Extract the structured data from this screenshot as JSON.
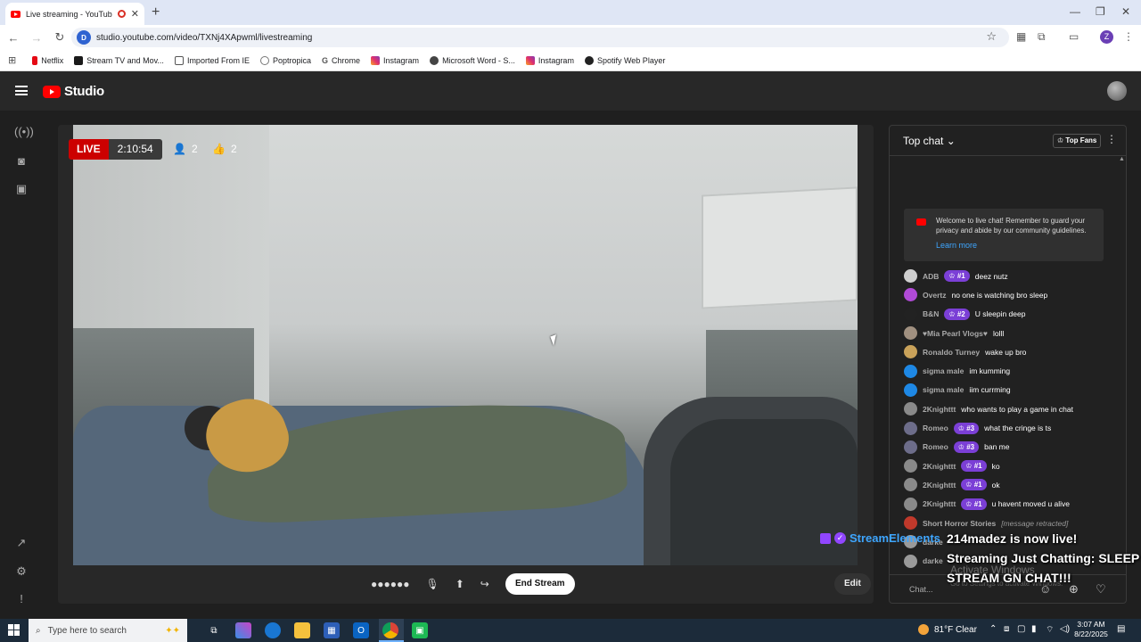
{
  "browser": {
    "tab_title": "Live streaming - YouTube Studio",
    "url": "studio.youtube.com/video/TXNj4XApwml/livestreaming",
    "profile_initial": "Z",
    "bookmarks": [
      "Netflix",
      "Stream TV and Mov...",
      "Imported From IE",
      "Poptropica",
      "Chrome",
      "Instagram",
      "Microsoft Word - S...",
      "Instagram",
      "Spotify Web Player"
    ]
  },
  "studio": {
    "logo_text": "Studio"
  },
  "stream": {
    "live_label": "LIVE",
    "elapsed": "2:10:54",
    "viewers": "2",
    "likes": "2",
    "end_label": "End Stream",
    "edit_label": "Edit"
  },
  "chat": {
    "title": "Top chat",
    "top_fans_label": "Top Fans",
    "welcome_text": "Welcome to live chat! Remember to guard your privacy and abide by our community guidelines.",
    "learn_more": "Learn more",
    "input_placeholder": "Chat...",
    "messages": [
      {
        "author": "ADB",
        "badge": "#1",
        "text": "deez nutz",
        "color": "#cfcfcf"
      },
      {
        "author": "Overtz",
        "badge": "",
        "text": "no one is watching bro sleep",
        "color": "#b04ad6"
      },
      {
        "author": "B&N",
        "badge": "#2",
        "text": "U sleepin deep",
        "color": "#222222"
      },
      {
        "author": "♥Mia Pearl Vlogs♥",
        "badge": "",
        "text": "lolll",
        "color": "#a09080"
      },
      {
        "author": "Ronaldo Turney",
        "badge": "",
        "text": "wake up bro",
        "color": "#c9a25a"
      },
      {
        "author": "sigma male",
        "badge": "",
        "text": "im kumming",
        "color": "#1e88e5"
      },
      {
        "author": "sigma male",
        "badge": "",
        "text": "iim currming",
        "color": "#1e88e5"
      },
      {
        "author": "2Knighttt",
        "badge": "",
        "text": "who wants to play a game in chat",
        "color": "#8a8a8a"
      },
      {
        "author": "Romeo",
        "badge": "#3",
        "text": "what the cringe is ts",
        "color": "#6d6d8a"
      },
      {
        "author": "Romeo",
        "badge": "#3",
        "text": "ban me",
        "color": "#6d6d8a"
      },
      {
        "author": "2Knighttt",
        "badge": "#1",
        "text": "ko",
        "color": "#8a8a8a"
      },
      {
        "author": "2Knighttt",
        "badge": "#1",
        "text": "ok",
        "color": "#8a8a8a"
      },
      {
        "author": "2Knighttt",
        "badge": "#1",
        "text": "u havent moved u alive",
        "color": "#8a8a8a"
      },
      {
        "author": "Short Horror Stories",
        "badge": "",
        "text": "[message retracted]",
        "color": "#c0392b",
        "retracted": true
      },
      {
        "author": "darke",
        "badge": "",
        "text": "",
        "color": "#9a9a9a"
      },
      {
        "author": "darke",
        "badge": "",
        "text": "",
        "color": "#9a9a9a"
      }
    ]
  },
  "overlay": {
    "brand": "StreamElements",
    "line1": "214madez is now live!",
    "line2": "Streaming Just Chatting: SLEEP",
    "line3": "STREAM GN CHAT!!!"
  },
  "windows": {
    "activate_title": "Activate Windows",
    "activate_sub": "Go to Settings to activate Windows.",
    "search_placeholder": "Type here to search",
    "weather": "81°F  Clear",
    "time": "3:07 AM",
    "date": "8/22/2025"
  }
}
